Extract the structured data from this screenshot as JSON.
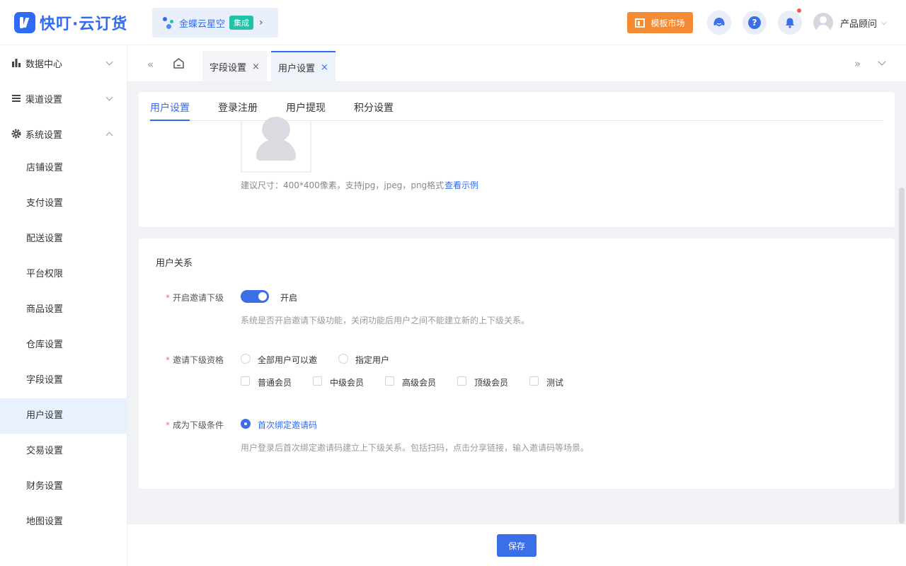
{
  "header": {
    "app_name": "快叮·云订货",
    "integration": {
      "label": "金蝶云星空",
      "badge": "集成",
      "arrow": "›"
    },
    "market_label": "模板市场",
    "help_glyph": "?",
    "user_name": "产品顾问",
    "user_caret": "⌵"
  },
  "sidebar": {
    "groups": [
      {
        "label": "数据中心",
        "icon": "bar-chart-icon",
        "expanded": false
      },
      {
        "label": "渠道设置",
        "icon": "list-icon",
        "expanded": false
      },
      {
        "label": "系统设置",
        "icon": "gear-icon",
        "expanded": true
      }
    ],
    "items": [
      "店铺设置",
      "支付设置",
      "配送设置",
      "平台权限",
      "商品设置",
      "仓库设置",
      "字段设置",
      "用户设置",
      "交易设置",
      "财务设置",
      "地图设置"
    ],
    "active_item": "用户设置"
  },
  "tabbar": {
    "left_arrows": "«",
    "right_arrows": "»",
    "tabs": [
      {
        "label": "字段设置",
        "close": "×"
      },
      {
        "label": "用户设置",
        "close": "×"
      }
    ],
    "active_tab": "用户设置"
  },
  "content": {
    "tabs": [
      "用户设置",
      "登录注册",
      "用户提现",
      "积分设置"
    ],
    "active_tab": "用户设置",
    "avatar_hint": "建议尺寸：400*400像素，支持jpg，jpeg，png格式",
    "avatar_example_link": "查看示例",
    "relation": {
      "title": "用户关系",
      "invite": {
        "label": "开启邀请下级",
        "enabled": true,
        "status": "开启",
        "desc": "系统是否开启邀请下级功能，关闭功能后用户之间不能建立新的上下级关系。"
      },
      "qualification": {
        "label": "邀请下级资格",
        "options": [
          "全部用户可以邀",
          "指定用户"
        ],
        "selected": null,
        "levels": [
          "普通会员",
          "中级会员",
          "高级会员",
          "顶级会员",
          "测试"
        ]
      },
      "condition": {
        "label": "成为下级条件",
        "option": "首次绑定邀请码",
        "selected": true,
        "desc": "用户登录后首次绑定邀请码建立上下级关系。包括扫码，点击分享链接，输入邀请码等场景。"
      }
    }
  },
  "footer": {
    "save_label": "保存"
  },
  "colors": {
    "primary": "#2f6bf6",
    "switch": "#3a6fe8",
    "market": "#f58a35",
    "badge": "#20c3a8",
    "required": "#f56c6c"
  }
}
